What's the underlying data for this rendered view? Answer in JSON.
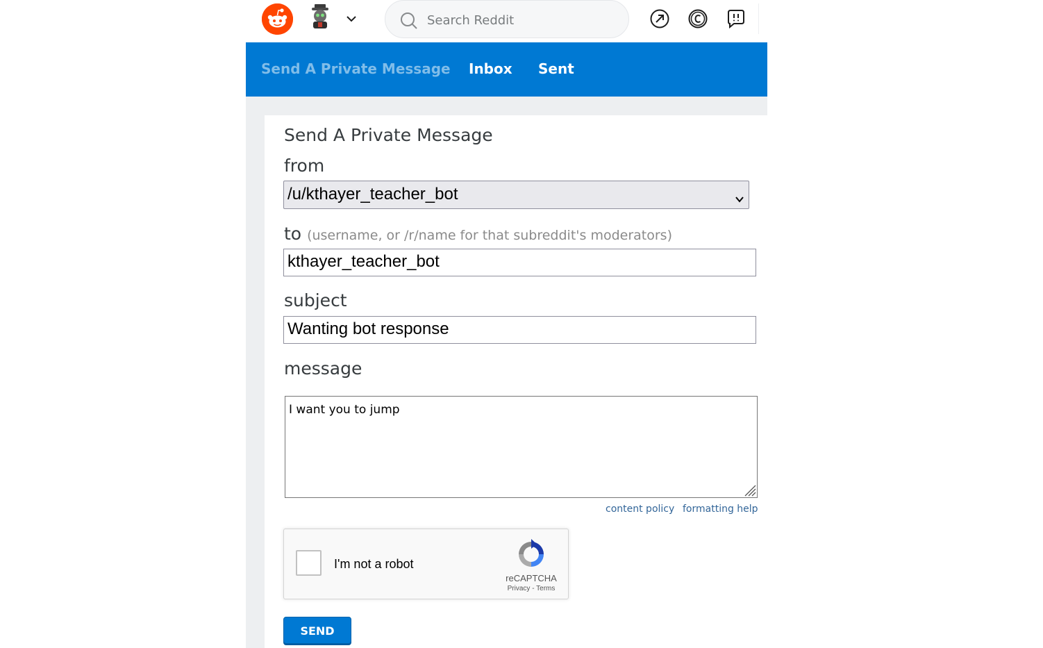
{
  "topbar": {
    "search_placeholder": "Search Reddit",
    "icons": [
      "reddit-logo",
      "user-avatar",
      "chevron-down-icon",
      "search-icon",
      "popular-icon",
      "coins-icon",
      "chat-icon"
    ],
    "brand_color": "#ff4500"
  },
  "nav": {
    "tabs": [
      {
        "label": "Send A Private Message",
        "active": true
      },
      {
        "label": "Inbox",
        "active": false
      },
      {
        "label": "Sent",
        "active": false
      }
    ],
    "bg_color": "#0079d3"
  },
  "form": {
    "title": "Send A Private Message",
    "from_label": "from",
    "from_value": "/u/kthayer_teacher_bot",
    "to_label": "to",
    "to_hint": "(username, or /r/name for that subreddit's moderators)",
    "to_value": "kthayer_teacher_bot",
    "subject_label": "subject",
    "subject_value": "Wanting bot response",
    "message_label": "message",
    "message_value": "I want you to jump",
    "content_policy_link": "content policy",
    "formatting_help_link": "formatting help",
    "send_label": "SEND"
  },
  "captcha": {
    "label": "I'm not a robot",
    "brand": "reCAPTCHA",
    "privacy": "Privacy",
    "separator": " - ",
    "terms": "Terms"
  }
}
